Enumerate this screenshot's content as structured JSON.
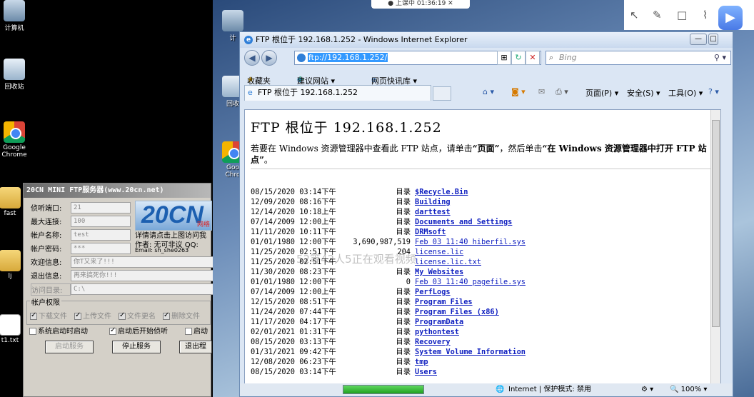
{
  "desktop": {
    "icons": [
      {
        "label": "计算机",
        "icon": "computer-icon"
      },
      {
        "label": "回收站",
        "icon": "recycle-bin-icon"
      },
      {
        "label": "Google Chrome",
        "icon": "chrome-icon"
      },
      {
        "label": "fast",
        "icon": "folder-icon"
      },
      {
        "label": "lj",
        "icon": "folder-icon"
      },
      {
        "label": "t1.txt",
        "icon": "text-file-icon"
      }
    ],
    "right_icons": [
      {
        "label": "计",
        "icon": "computer-icon"
      },
      {
        "label": "回收",
        "icon": "recycle-bin-icon"
      },
      {
        "label": "Goo Chro",
        "icon": "chrome-icon"
      }
    ]
  },
  "ftp_app": {
    "title": "20CN MINI FTP服务器(www.20cn.net)",
    "port_label": "侦听端口:",
    "port_value": "21",
    "maxconn_label": "最大连接:",
    "maxconn_value": "100",
    "user_label": "帐户名称:",
    "user_value": "test",
    "pass_label": "帐户密码:",
    "pass_value": "***",
    "welcome_label": "欢迎信息:",
    "welcome_value": "你T又来了!!!",
    "exit_label": "退出信息:",
    "exit_value": "再来搞死你!!!",
    "dir_label": "访问目录:",
    "dir_value": "C:\\",
    "logo_text": "20CN",
    "logo_sub": "网络",
    "info_line1": "详情请点击上图访问我",
    "info_line2": "作者: 无可非议 QQ:",
    "info_line3": "Email: sh_she0263",
    "perm_title": "帐户权限",
    "perms": [
      "下载文件",
      "上传文件",
      "文件更名",
      "删除文件"
    ],
    "opt_autostart": "系统启动时启动",
    "opt_listen": "启动后开始侦听",
    "opt_third": "启动",
    "btn_start": "启动服务",
    "btn_stop": "停止服务",
    "btn_exit": "退出程"
  },
  "browser": {
    "window_title": "FTP 根位于 192.168.1.252 - Windows Internet Explorer",
    "address": "ftp://192.168.1.252/",
    "search_placeholder": "Bing",
    "fav_label": "收藏夹",
    "fav_suggest": "建议网站 ▾",
    "fav_slices": "网页快讯库 ▾",
    "tab_title": "FTP 根位于 192.168.1.252",
    "cmd_page": "页面(P) ▾",
    "cmd_safety": "安全(S) ▾",
    "cmd_tools": "工具(O) ▾",
    "page_heading": "FTP 根位于 192.168.1.252",
    "hint_pre": "若要在 Windows 资源管理器中查看此 FTP 站点，请单击",
    "hint_b1": "“页面”",
    "hint_mid": "，然后单击",
    "hint_b2": "“在 Windows 资源管理器中打开 FTP 站点”",
    "hint_end": "。",
    "watermark": "52等42人5正在观看视频",
    "status_zone": "Internet | 保护模式: 禁用",
    "zoom": "100%",
    "progress": 1.0
  },
  "listing": [
    {
      "date": "08/15/2020 03:14下午",
      "size": "目录",
      "name": "$Recycle.Bin",
      "dir": true
    },
    {
      "date": "12/09/2020 08:16下午",
      "size": "目录",
      "name": "Building",
      "dir": true
    },
    {
      "date": "12/14/2020 10:18上午",
      "size": "目录",
      "name": "darttest",
      "dir": true
    },
    {
      "date": "07/14/2009 12:00上午",
      "size": "目录",
      "name": "Documents and Settings",
      "dir": true
    },
    {
      "date": "11/11/2020 10:11下午",
      "size": "目录",
      "name": "DRMsoft",
      "dir": true
    },
    {
      "date": "01/01/1980 12:00下午",
      "size": "3,690,987,519",
      "name": "Feb 03 11:40 hiberfil.sys",
      "dir": false
    },
    {
      "date": "11/25/2020 02:51下午",
      "size": "204",
      "name": "license.lic",
      "dir": false
    },
    {
      "date": "11/25/2020 02:51下午",
      "size": "",
      "name": "license.lic.txt",
      "dir": false
    },
    {
      "date": "11/30/2020 08:23下午",
      "size": "目录",
      "name": "My Websites",
      "dir": true
    },
    {
      "date": "01/01/1980 12:00下午",
      "size": "0",
      "name": "Feb 03 11:40 pagefile.sys",
      "dir": false
    },
    {
      "date": "07/14/2009 12:00上午",
      "size": "目录",
      "name": "PerfLogs",
      "dir": true
    },
    {
      "date": "12/15/2020 08:51下午",
      "size": "目录",
      "name": "Program Files",
      "dir": true
    },
    {
      "date": "11/24/2020 07:44下午",
      "size": "目录",
      "name": "Program Files (x86)",
      "dir": true
    },
    {
      "date": "11/17/2020 04:17下午",
      "size": "目录",
      "name": "ProgramData",
      "dir": true
    },
    {
      "date": "02/01/2021 01:31下午",
      "size": "目录",
      "name": "pythontest",
      "dir": true
    },
    {
      "date": "08/15/2020 03:13下午",
      "size": "目录",
      "name": "Recovery",
      "dir": true
    },
    {
      "date": "01/31/2021 09:42下午",
      "size": "目录",
      "name": "System Volume Information",
      "dir": true
    },
    {
      "date": "12/08/2020 06:23下午",
      "size": "目录",
      "name": "tmp",
      "dir": true
    },
    {
      "date": "08/15/2020 03:14下午",
      "size": "目录",
      "name": "Users",
      "dir": true
    }
  ],
  "overlay": {
    "timer": "● 上课中 01:36:19 ✕",
    "vlogo": "▶"
  }
}
